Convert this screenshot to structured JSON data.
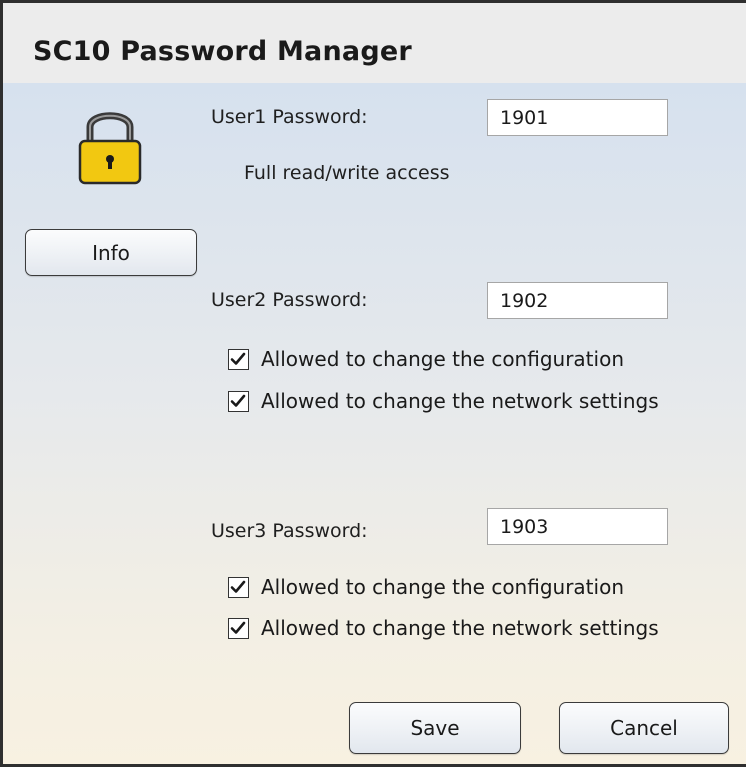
{
  "window": {
    "title": "SC10 Password Manager"
  },
  "info_button": {
    "label": "Info"
  },
  "user1": {
    "label": "User1 Password:",
    "value": "1901",
    "access_text": "Full read/write access"
  },
  "user2": {
    "label": "User2 Password:",
    "value": "1902",
    "options": [
      {
        "label": "Allowed to change the configuration",
        "checked": true
      },
      {
        "label": "Allowed to change the network settings",
        "checked": true
      }
    ]
  },
  "user3": {
    "label": "User3 Password:",
    "value": "1903",
    "options": [
      {
        "label": "Allowed to change the configuration",
        "checked": true
      },
      {
        "label": "Allowed to change the network settings",
        "checked": true
      }
    ]
  },
  "footer": {
    "save_label": "Save",
    "cancel_label": "Cancel"
  },
  "icons": {
    "lock": "padlock-icon",
    "check": "checkmark-icon"
  },
  "colors": {
    "lock_body": "#f2c811",
    "lock_shackle": "#3a3a3a",
    "content_top": "#d6e1ee",
    "content_bottom": "#f8f1e1"
  }
}
